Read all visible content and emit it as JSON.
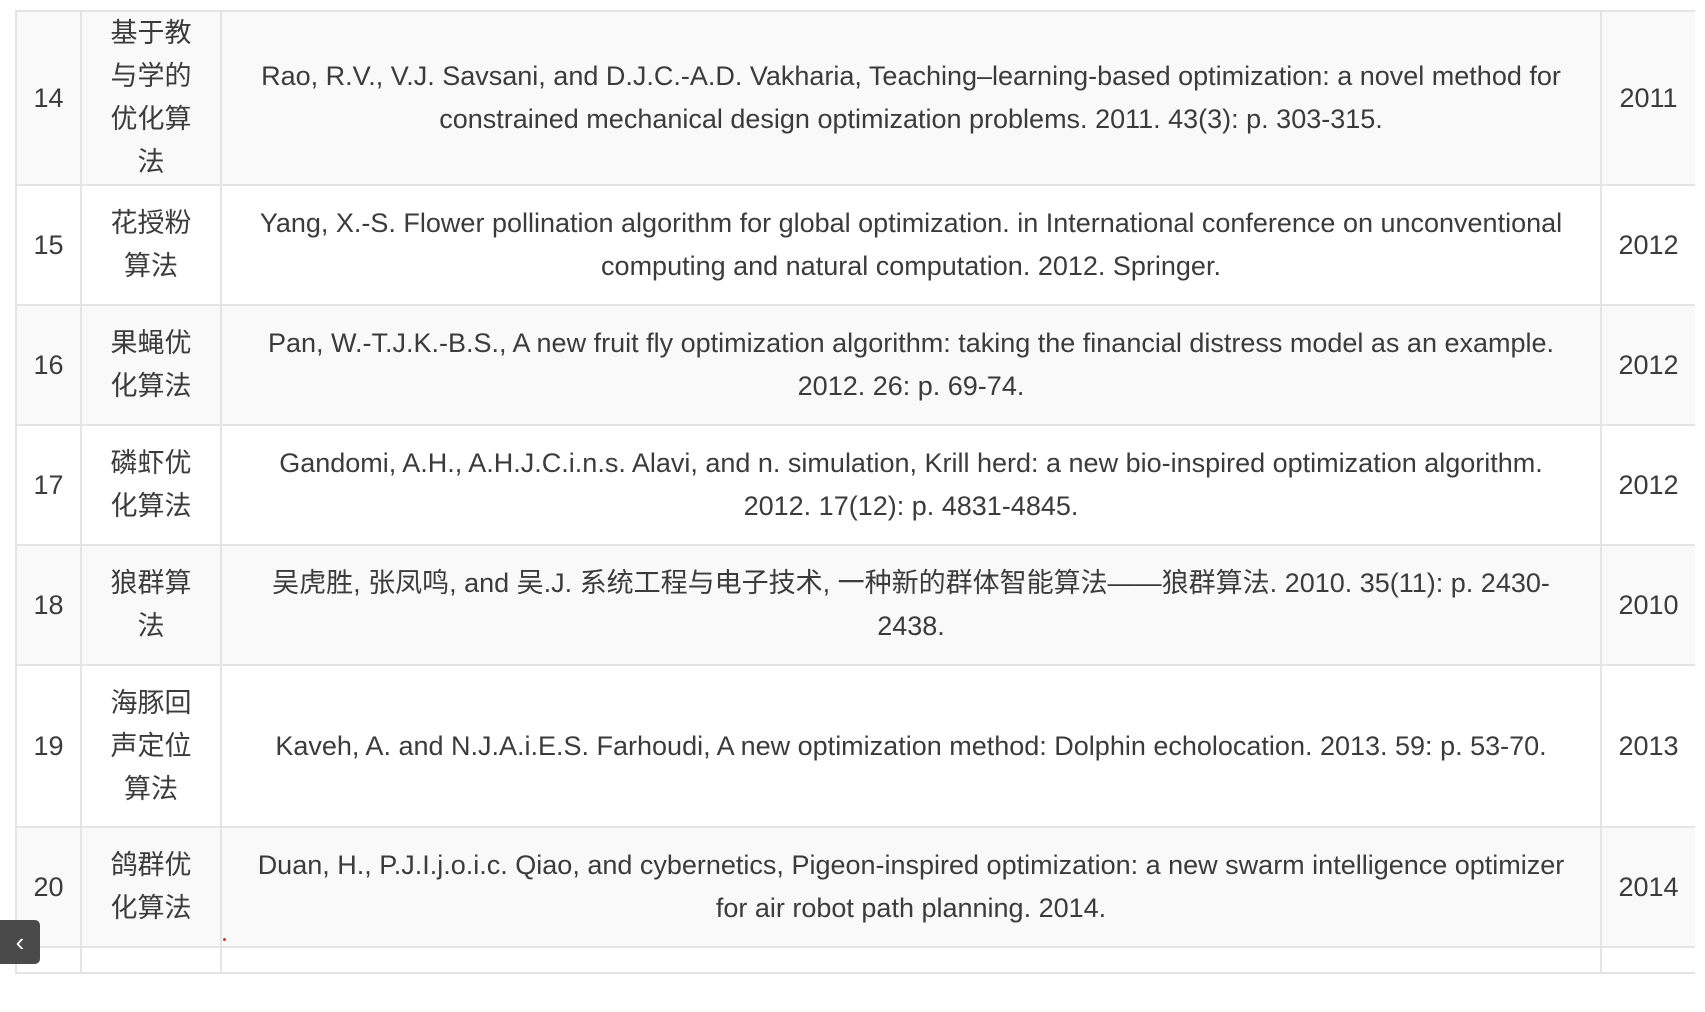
{
  "rows": [
    {
      "num": "14",
      "name": "基于教与学的优化算法",
      "reference": "Rao, R.V., V.J. Savsani, and D.J.C.-A.D. Vakharia, Teaching–learning-based optimization: a novel method for constrained mechanical design optimization problems. 2011. 43(3): p. 303-315.",
      "year": "2011"
    },
    {
      "num": "15",
      "name": "花授粉算法",
      "reference": "Yang, X.-S. Flower pollination algorithm for global optimization. in International conference on unconventional computing and natural computation. 2012. Springer.",
      "year": "2012"
    },
    {
      "num": "16",
      "name": "果蝇优化算法",
      "reference": "Pan, W.-T.J.K.-B.S., A new fruit fly optimization algorithm: taking the financial distress model as an example. 2012. 26: p. 69-74.",
      "year": "2012"
    },
    {
      "num": "17",
      "name": "磷虾优化算法",
      "reference": "Gandomi, A.H., A.H.J.C.i.n.s. Alavi, and n. simulation, Krill herd: a new bio-inspired optimization algorithm. 2012. 17(12): p. 4831-4845.",
      "year": "2012"
    },
    {
      "num": "18",
      "name": "狼群算法",
      "reference": "吴虎胜, 张凤鸣, and 吴.J. 系统工程与电子技术, 一种新的群体智能算法——狼群算法. 2010. 35(11): p. 2430-2438.",
      "year": "2010"
    },
    {
      "num": "19",
      "name": "海豚回声定位算法",
      "reference": "Kaveh, A. and N.J.A.i.E.S. Farhoudi, A new optimization method: Dolphin echolocation. 2013. 59: p. 53-70.",
      "year": "2013"
    },
    {
      "num": "20",
      "name": "鸽群优化算法",
      "reference": "Duan, H., P.J.I.j.o.i.c. Qiao, and cybernetics, Pigeon-inspired optimization: a new swarm intelligence optimizer for air robot path planning. 2014.",
      "year": "2014"
    }
  ],
  "nav": {
    "back_glyph": "‹"
  },
  "colors": {
    "text": "#3b3b3b",
    "border": "#e4e4e4",
    "row_stripe": "#f9f9f9",
    "nav_bg": "#4a4a4a"
  }
}
